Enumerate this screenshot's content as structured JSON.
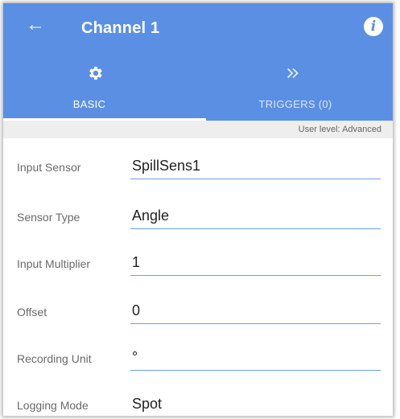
{
  "header": {
    "back_icon": "arrow-left-icon",
    "title": "Channel 1",
    "info_icon": "info-icon",
    "accent_color": "#5b8fe4"
  },
  "tabs": [
    {
      "label": "BASIC",
      "icon": "gear-icon",
      "selected": true
    },
    {
      "label": "TRIGGERS (0)",
      "icon": "double-chevron-right-icon",
      "selected": false
    }
  ],
  "user_level": "User level: Advanced",
  "fields": [
    {
      "label": "Input Sensor",
      "value": "SpillSens1"
    },
    {
      "label": "Sensor Type",
      "value": "Angle"
    },
    {
      "label": "Input Multiplier",
      "value": "1"
    },
    {
      "label": "Offset",
      "value": "0"
    },
    {
      "label": "Recording Unit",
      "value": "°"
    },
    {
      "label": "Logging Mode",
      "value": "Spot"
    }
  ]
}
